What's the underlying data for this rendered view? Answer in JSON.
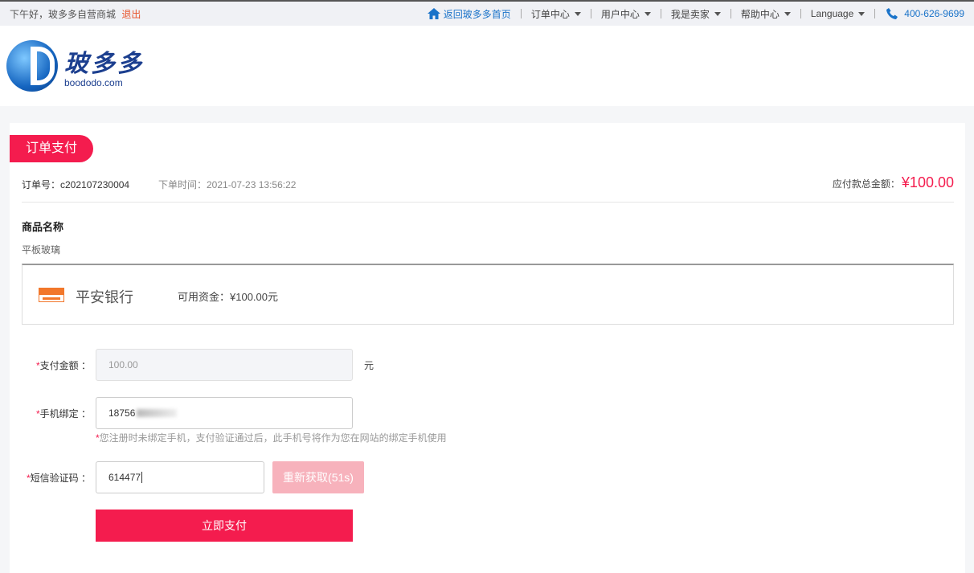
{
  "topbar": {
    "greeting": "下午好，玻多多自营商城",
    "logout": "退出",
    "home": "返回玻多多首页",
    "nav": [
      "订单中心",
      "用户中心",
      "我是卖家",
      "帮助中心",
      "Language"
    ],
    "phone": "400-626-9699"
  },
  "logo": {
    "cn": "玻多多",
    "en": "boododo.com"
  },
  "page": {
    "tag": "订单支付",
    "order_no": "订单号：c202107230004",
    "order_time": "下单时间：2021-07-23 13:56:22",
    "total_label": "应付款总金额：",
    "total_amount": "¥100.00",
    "goods_title": "商品名称",
    "goods_name": "平板玻璃"
  },
  "bank": {
    "name": "平安银行",
    "funds": "可用资金：¥100.00元"
  },
  "form": {
    "amount_label": "支付金额 ：",
    "amount_value": "100.00",
    "amount_unit": "元",
    "phone_label": "手机绑定 ：",
    "phone_value": "18756",
    "hint": "您注册时未绑定手机，支付验证通过后，此手机号将作为您在网站的绑定手机使用",
    "sms_label": "短信验证码 ：",
    "sms_value": "614477",
    "resend": "重新获取(51s)",
    "pay": "立即支付"
  },
  "colors": {
    "accent": "#f41c4e",
    "link": "#1a73c9"
  }
}
